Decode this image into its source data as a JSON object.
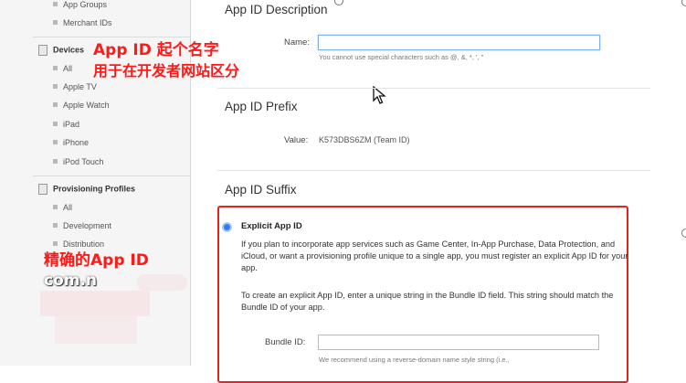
{
  "sidebar": {
    "top_items": [
      "App Groups",
      "Merchant IDs"
    ],
    "devices": {
      "label": "Devices",
      "items": [
        "All",
        "Apple TV",
        "Apple Watch",
        "iPad",
        "iPhone",
        "iPod Touch"
      ]
    },
    "profiles": {
      "label": "Provisioning Profiles",
      "items": [
        "All",
        "Development",
        "Distribution"
      ]
    }
  },
  "annotations": {
    "red1": "App ID 起个名字",
    "red2": "用于在开发者网站区分",
    "red3": "精确的App ID",
    "white1": "com.n"
  },
  "description": {
    "title": "App ID Description",
    "name_label": "Name:",
    "name_value": "",
    "name_hint": "You cannot use special characters such as @, &, *, ', \""
  },
  "prefix": {
    "title": "App ID Prefix",
    "value_label": "Value:",
    "value": "K573DBS6ZM (Team ID)"
  },
  "suffix": {
    "title": "App ID Suffix",
    "explicit_label": "Explicit App ID",
    "explicit_desc": "If you plan to incorporate app services such as Game Center, In-App Purchase, Data Protection, and iCloud, or want a provisioning profile unique to a single app, you must register an explicit App ID for your app.",
    "explicit_instr": "To create an explicit App ID, enter a unique string in the Bundle ID field. This string should match the Bundle ID of your app.",
    "bundle_label": "Bundle ID:",
    "bundle_value": "",
    "bundle_hint": "We recommend using a reverse-domain name style string (i.e.,"
  }
}
